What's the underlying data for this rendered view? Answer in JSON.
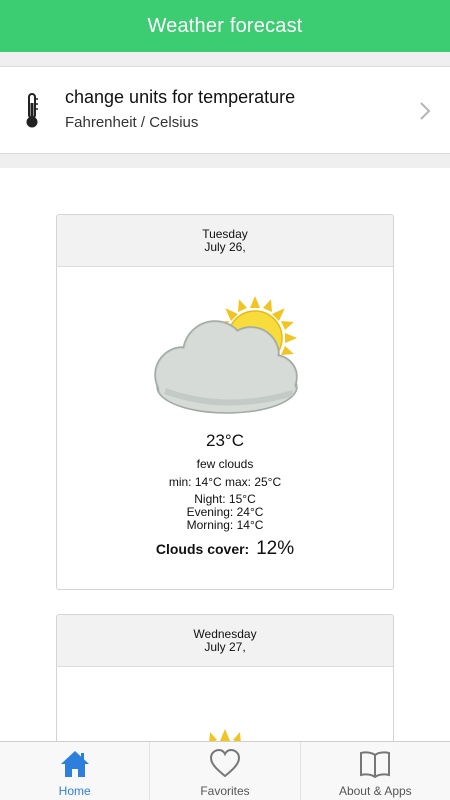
{
  "header": {
    "title": "Weather forecast"
  },
  "settings": {
    "title": "change units for temperature",
    "subtitle": "Fahrenheit / Celsius",
    "icon": "thermometer-icon"
  },
  "forecasts": [
    {
      "day": "Tuesday",
      "date": "July 26,",
      "icon": "partly-cloudy-icon",
      "temp": "23°C",
      "desc": "few clouds",
      "minmax": "min: 14°C max: 25°C",
      "night": "Night: 15°C",
      "evening": "Evening: 24°C",
      "morning": "Morning: 14°C",
      "clouds_label": "Clouds cover:",
      "clouds_value": "12%"
    },
    {
      "day": "Wednesday",
      "date": "July 27,",
      "icon": "sun-icon"
    }
  ],
  "tabs": [
    {
      "label": "Home",
      "icon": "home-icon",
      "active": true
    },
    {
      "label": "Favorites",
      "icon": "heart-icon",
      "active": false
    },
    {
      "label": "About & Apps",
      "icon": "book-icon",
      "active": false
    }
  ],
  "colors": {
    "header": "#3ccd73",
    "active_tab": "#2e7fdc",
    "sun": "#f5d93a",
    "cloud": "#c9cfcb"
  }
}
